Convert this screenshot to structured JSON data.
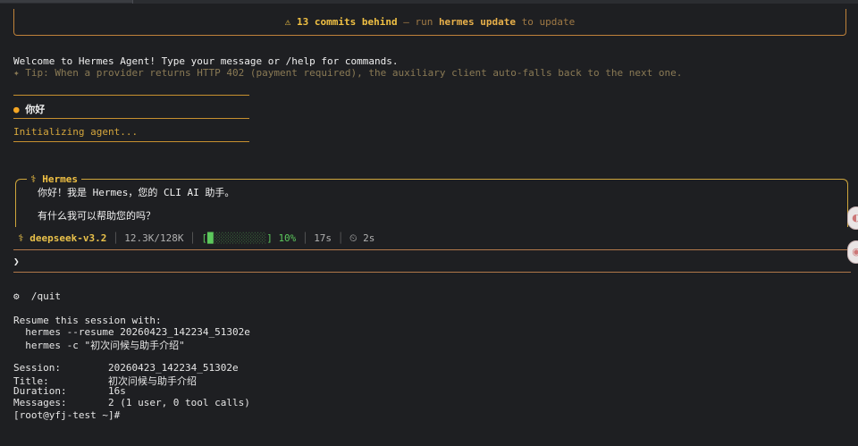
{
  "banner": {
    "warn_text": "⚠ 13 commits behind",
    "sep": " — run ",
    "cmd": "hermes update",
    "tail": " to update"
  },
  "welcome": "Welcome to Hermes Agent! Type your message or /help for commands.",
  "tip": "✦ Tip: When a provider returns HTTP 402 (payment required), the auxiliary client auto-falls back to the next one.",
  "user_message": {
    "bullet": "●",
    "text": "你好"
  },
  "initializing": "Initializing agent...",
  "response": {
    "label": "⚕ Hermes",
    "line1": "你好！我是 Hermes，您的 CLI AI 助手。",
    "line2": "有什么我可以帮助您的吗？"
  },
  "status_bar": {
    "model": "⚕ deepseek-v3.2",
    "tokens": "12.3K/128K",
    "bar_open": "[",
    "bar_fill": "█",
    "bar_empty": "░░░░░░░░░",
    "bar_close": "]",
    "percent": "10%",
    "progress": 0.1,
    "elapsed": "17s",
    "timer": "⏲ 2s"
  },
  "prompt": "❯",
  "quit_cmd": "⚙  /quit",
  "resume": {
    "header": "Resume this session with:",
    "cmd1": "  hermes --resume 20260423_142234_51302e",
    "cmd2": "  hermes -c \"初次问候与助手介绍\""
  },
  "session_info": {
    "session": "Session:        20260423_142234_51302e",
    "title": "Title:          初次问候与助手介绍",
    "duration": "Duration:       16s",
    "messages": "Messages:       2 (1 user, 0 tool calls)"
  },
  "shell_prompt": "[root@yfj-test ~]#",
  "colors": {
    "background": "#1e1f22",
    "accent_gold": "#f0c043",
    "accent_orange": "#c0823a",
    "progress_green": "#5cc85c"
  }
}
